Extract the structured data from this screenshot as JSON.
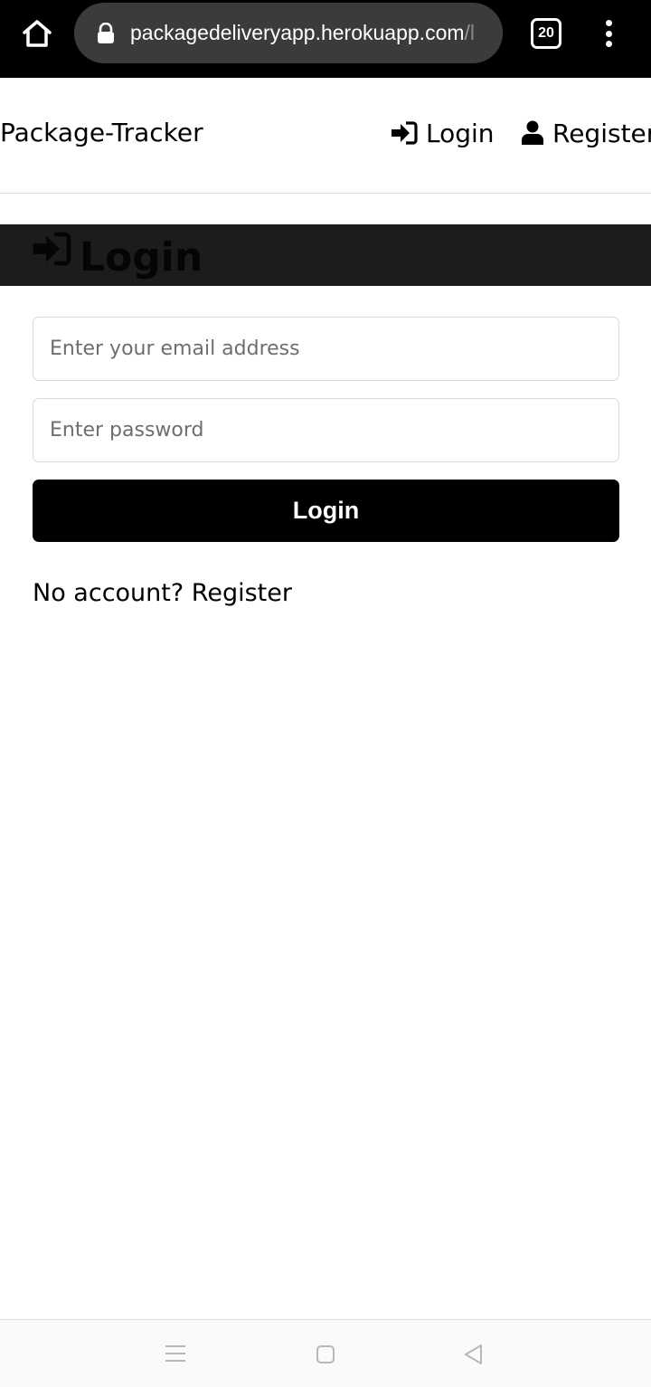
{
  "browser": {
    "url_host": "packagedeliveryapp.herokuapp.com",
    "url_path": "/l",
    "tab_count": "20"
  },
  "navbar": {
    "brand": "Package-Tracker",
    "login_label": "Login",
    "register_label": "Register"
  },
  "page": {
    "title": "Login"
  },
  "form": {
    "email_placeholder": "Enter your email address",
    "password_placeholder": "Enter password",
    "submit_label": "Login",
    "no_account_text": "No account? ",
    "register_link": "Register"
  },
  "icons": {
    "home": "home-icon",
    "lock": "lock-icon",
    "menu": "more-vert-icon",
    "login": "sign-in-icon",
    "register": "user-icon"
  },
  "colors": {
    "title_band": "#1c1c1c",
    "button": "#000000",
    "browser_bar": "#000000",
    "url_pill": "#3b3b3d"
  }
}
